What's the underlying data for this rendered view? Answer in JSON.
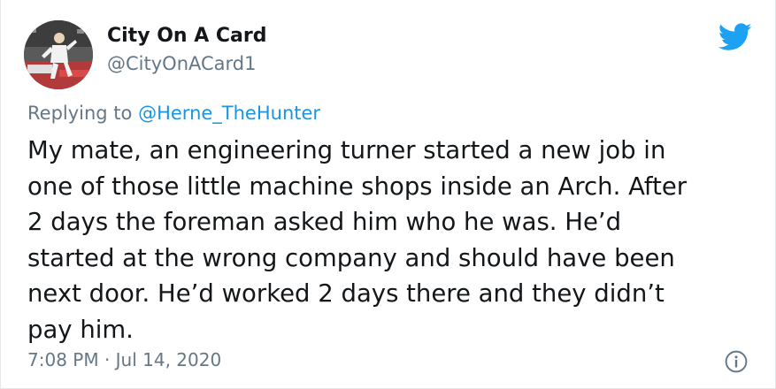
{
  "author": {
    "display_name": "City On A Card",
    "handle": "@CityOnACard1",
    "avatar_icon": "football-player-avatar"
  },
  "reply": {
    "prefix": "Replying to",
    "mention": "@Herne_TheHunter"
  },
  "tweet": {
    "lines": [
      "My mate, an engineering turner started a new job in",
      "one of those little machine shops inside an Arch. After",
      "2 days the foreman asked him who he was. He’d",
      "started at the wrong company and should have been",
      "next door. He’d worked 2 days there and they didn’t",
      "pay him."
    ],
    "timestamp": "7:08 PM · Jul 14, 2020"
  },
  "icons": {
    "brand": "twitter-bird-icon",
    "info": "info-icon"
  },
  "colors": {
    "brand_blue": "#1da1f2",
    "link_blue": "#1b95e0",
    "muted_gray": "#657786",
    "text_dark": "#14171a"
  }
}
